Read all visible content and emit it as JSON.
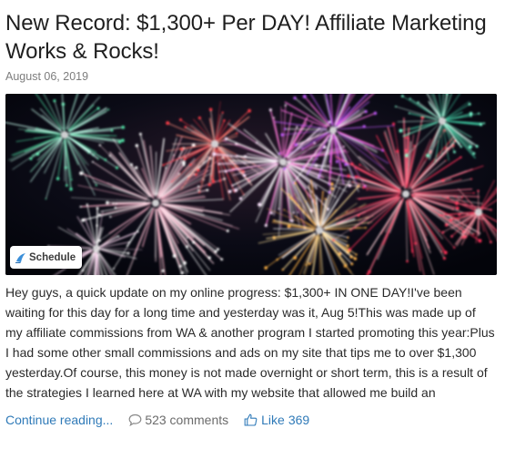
{
  "post": {
    "title": "New Record: $1,300+ Per DAY! Affiliate Marketing Works & Rocks!",
    "date": "August 06, 2019",
    "excerpt_lines": [
      "Hey guys, a quick update on my online progress: $1,300+ IN ONE DAY!I've been",
      "waiting for this day for a long time and yesterday was it, Aug 5!This was made up of",
      "my affiliate commissions from WA & another program I started promoting this year:Plus",
      "I had some other small commissions and ads on my site that tips me to over $1,300",
      "yesterday.Of course, this money is not made overnight or short term, this is a result of",
      "the strategies I learned here at WA with my website that allowed me build an"
    ]
  },
  "hero_image": {
    "icon": "fireworks-image",
    "schedule_label": "Schedule",
    "schedule_icon": "schedule-logo-icon"
  },
  "actions": {
    "continue_label": "Continue reading...",
    "comments_label": "523 comments",
    "comments_icon": "comment-bubble-icon",
    "like_label": "Like",
    "like_count": "369",
    "like_icon": "thumbs-up-icon"
  },
  "colors": {
    "link": "#2f7ab8",
    "muted": "#7d7d7d",
    "text": "#222222"
  }
}
